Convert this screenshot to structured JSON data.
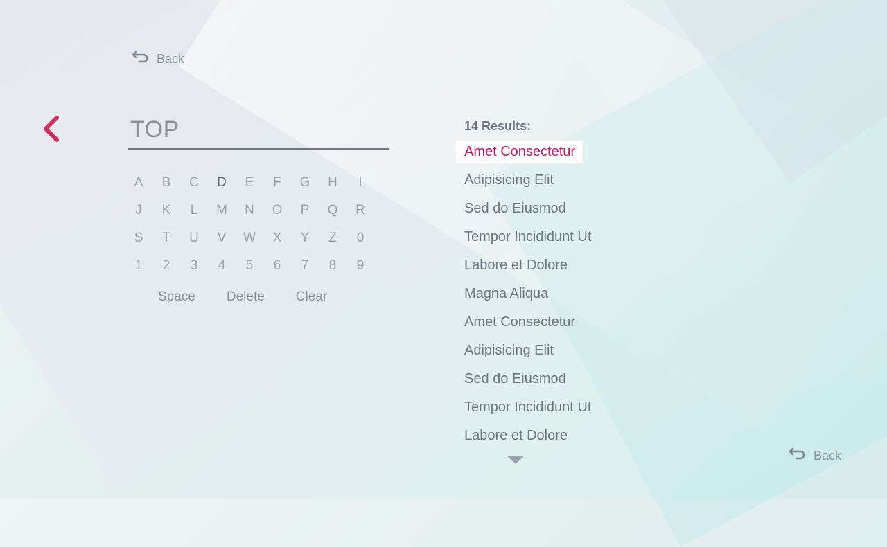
{
  "nav": {
    "back_top_label": "Back",
    "back_bottom_label": "Back"
  },
  "search": {
    "query": "TOP"
  },
  "keyboard": {
    "rows": [
      [
        "A",
        "B",
        "C",
        "D",
        "E",
        "F",
        "G",
        "H",
        "I"
      ],
      [
        "J",
        "K",
        "L",
        "M",
        "N",
        "O",
        "P",
        "Q",
        "R"
      ],
      [
        "S",
        "T",
        "U",
        "V",
        "W",
        "X",
        "Y",
        "Z",
        "0"
      ],
      [
        "1",
        "2",
        "3",
        "4",
        "5",
        "6",
        "7",
        "8",
        "9"
      ]
    ],
    "active_key": "D",
    "actions": {
      "space": "Space",
      "delete": "Delete",
      "clear": "Clear"
    }
  },
  "results": {
    "header": "14 Results:",
    "items": [
      "Amet Consectetur",
      "Adipisicing Elit",
      "Sed do Eiusmod",
      "Tempor Incididunt Ut",
      "Labore et Dolore",
      "Magna Aliqua",
      "Amet Consectetur",
      "Adipisicing Elit",
      "Sed do Eiusmod",
      "Tempor Incididunt Ut",
      "Labore et Dolore"
    ],
    "selected_index": 0
  },
  "colors": {
    "accent": "#d1155c",
    "text": "#6e7680",
    "muted": "#9aa2ab"
  },
  "icons": {
    "back": "back-arrow-icon",
    "prev": "chevron-left-icon",
    "scroll": "triangle-down-icon"
  }
}
